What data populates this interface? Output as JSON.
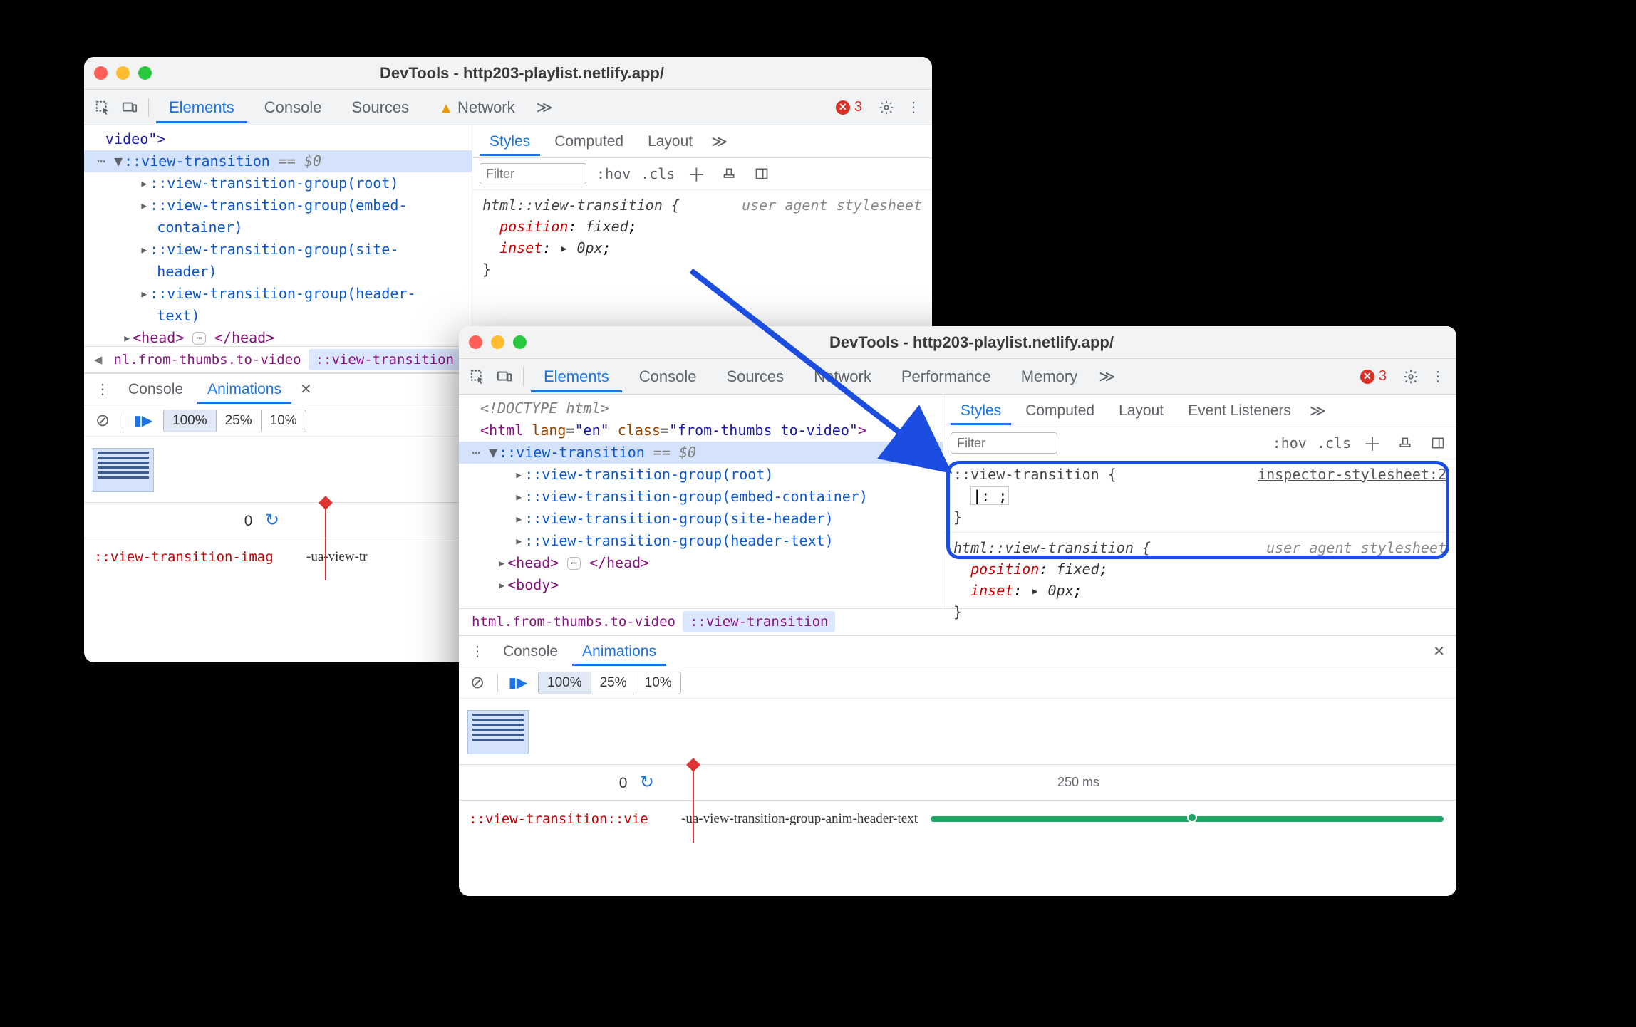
{
  "colors": {
    "accent": "#1a73e8",
    "callout": "#1a4de0",
    "error": "#d93025"
  },
  "w1": {
    "title": "DevTools - http203-playlist.netlify.app/",
    "tabs": [
      "Elements",
      "Console",
      "Sources",
      "Network"
    ],
    "active_tab": "Elements",
    "network_has_warning": true,
    "errors": 3,
    "tree": {
      "line0": " video\">",
      "sel": "::view-transition",
      "sel_suffix": " == $0",
      "groups": [
        "::view-transition-group(root)",
        "::view-transition-group(embed-container)",
        "::view-transition-group(site-header)",
        "::view-transition-group(header-text)"
      ],
      "head_open": "<head>",
      "head_close": "</head>"
    },
    "crumb": {
      "left": "nl.from-thumbs.to-video",
      "active": "::view-transition"
    },
    "sidebar": {
      "tabs": [
        "Styles",
        "Computed",
        "Layout"
      ],
      "active": "Styles",
      "filter_placeholder": "Filter",
      "tools": [
        ":hov",
        ".cls"
      ],
      "rule1": {
        "selector": "html::view-transition {",
        "source": "user agent stylesheet",
        "props": [
          {
            "n": "position",
            "v": "fixed"
          },
          {
            "n": "inset",
            "v": "▸ 0px"
          }
        ],
        "close": "}"
      }
    },
    "drawer": {
      "tabs": [
        "Console",
        "Animations"
      ],
      "active": "Animations",
      "speeds": [
        "100%",
        "25%",
        "10%"
      ],
      "active_speed": "100%",
      "zero": "0",
      "row_name": "::view-transition-imag",
      "anim_label": "-ua-view-tr"
    }
  },
  "w2": {
    "title": "DevTools - http203-playlist.netlify.app/",
    "tabs": [
      "Elements",
      "Console",
      "Sources",
      "Network",
      "Performance",
      "Memory"
    ],
    "active_tab": "Elements",
    "errors": 3,
    "tree": {
      "doctype": "<!DOCTYPE html>",
      "html_open_1": "<html lang=",
      "html_lang": "\"en\"",
      "html_open_2": " class=",
      "html_class": "\"from-thumbs to-video\"",
      "html_open_3": ">",
      "sel": "::view-transition",
      "sel_suffix": " == $0",
      "groups": [
        "::view-transition-group(root)",
        "::view-transition-group(embed-container)",
        "::view-transition-group(site-header)",
        "::view-transition-group(header-text)"
      ],
      "head_open": "<head>",
      "head_close": "</head>",
      "body_open": "<body>"
    },
    "crumb": {
      "left": "html.from-thumbs.to-video",
      "active": "::view-transition"
    },
    "sidebar": {
      "tabs": [
        "Styles",
        "Computed",
        "Layout",
        "Event Listeners"
      ],
      "active": "Styles",
      "filter_placeholder": "Filter",
      "tools": [
        ":hov",
        ".cls"
      ],
      "rule_new": {
        "selector": "::view-transition {",
        "source": "inspector-stylesheet:2",
        "empty_prop": "|:  ;",
        "close": "}"
      },
      "rule1": {
        "selector": "html::view-transition {",
        "source": "user agent stylesheet",
        "props": [
          {
            "n": "position",
            "v": "fixed"
          },
          {
            "n": "inset",
            "v": "▸ 0px"
          }
        ],
        "close": "}"
      }
    },
    "drawer": {
      "tabs": [
        "Console",
        "Animations"
      ],
      "active": "Animations",
      "speeds": [
        "100%",
        "25%",
        "10%"
      ],
      "active_speed": "100%",
      "zero": "0",
      "tick": "250 ms",
      "row_name": "::view-transition::vie",
      "anim_label": "-ua-view-transition-group-anim-header-text"
    }
  }
}
